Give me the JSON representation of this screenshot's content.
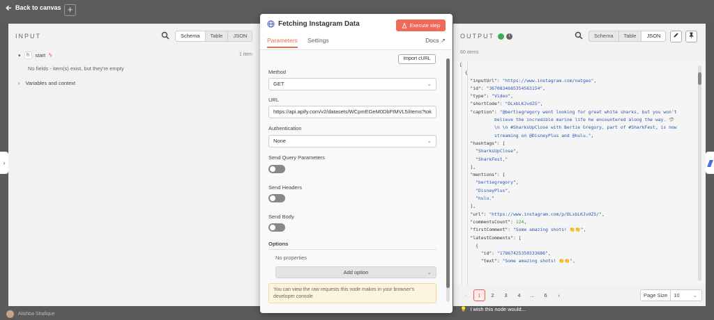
{
  "topbar": {
    "back_label": "Back to canvas",
    "plus_label": "+"
  },
  "input_panel": {
    "title": "INPUT",
    "views": [
      "Schema",
      "Table",
      "JSON"
    ],
    "active_view": "Schema",
    "start_label": "start",
    "item_count": "1 item",
    "empty_message": "No fields - item(s) exist, but they're empty",
    "vars_label": "Variables and context"
  },
  "modal": {
    "title": "Fetching Instagram Data",
    "execute_label": "Execute step",
    "tabs": [
      "Parameters",
      "Settings"
    ],
    "docs_label": "Docs",
    "import_label": "Import cURL",
    "method_label": "Method",
    "method_value": "GET",
    "url_label": "URL",
    "url_value": "https://api.apify.com/v2/datasets/WCpmEGeM0DbFtMVL5/items?tok",
    "auth_label": "Authentication",
    "auth_value": "None",
    "query_label": "Send Query Parameters",
    "headers_label": "Send Headers",
    "body_label": "Send Body",
    "options_label": "Options",
    "no_props": "No properties",
    "add_option": "Add option",
    "note": "You can view the raw requests this node makes in your browser's developer console"
  },
  "output_panel": {
    "title": "OUTPUT",
    "views": [
      "Schema",
      "Table",
      "JSON"
    ],
    "active_view": "JSON",
    "item_count": "60 items",
    "json_lines": [
      [
        {
          "t": "p",
          "v": "["
        }
      ],
      [
        {
          "t": "p",
          "v": "  {"
        }
      ],
      [
        {
          "t": "k",
          "v": "    \"inputUrl\": "
        },
        {
          "t": "s",
          "v": "\"https://www.instagram.com/natgeo\""
        },
        {
          "t": "p",
          "v": ","
        }
      ],
      [
        {
          "t": "k",
          "v": "    \"id\": "
        },
        {
          "t": "s",
          "v": "\"3670834685354563154\""
        },
        {
          "t": "p",
          "v": ","
        }
      ],
      [
        {
          "t": "k",
          "v": "    \"type\": "
        },
        {
          "t": "s",
          "v": "\"Video\""
        },
        {
          "t": "p",
          "v": ","
        }
      ],
      [
        {
          "t": "k",
          "v": "    \"shortCode\": "
        },
        {
          "t": "s",
          "v": "\"DLxbLKJvdZS\""
        },
        {
          "t": "p",
          "v": ","
        }
      ],
      [
        {
          "t": "k",
          "v": "    \"caption\": "
        },
        {
          "t": "s",
          "v": "\"@bertiegregory went looking for great white sharks, but you won't"
        }
      ],
      [
        {
          "t": "s",
          "v": "             believe the incredible marine life he encountered along the way. 🦈"
        }
      ],
      [
        {
          "t": "s",
          "v": "             \\n \\n #SharksUpClose with Bertie Gregory, part of #SharkFest, is now"
        }
      ],
      [
        {
          "t": "s",
          "v": "             streaming on @DisneyPlus and @hulu.\""
        },
        {
          "t": "p",
          "v": ","
        }
      ],
      [
        {
          "t": "k",
          "v": "    \"hashtags\": ["
        }
      ],
      [
        {
          "t": "s",
          "v": "      \"SharksUpClose\""
        },
        {
          "t": "p",
          "v": ","
        }
      ],
      [
        {
          "t": "s",
          "v": "      \"SharkFest,\""
        }
      ],
      [
        {
          "t": "p",
          "v": "    ],"
        }
      ],
      [
        {
          "t": "k",
          "v": "    \"mentions\": ["
        }
      ],
      [
        {
          "t": "s",
          "v": "      \"bertiegregory\""
        },
        {
          "t": "p",
          "v": ","
        }
      ],
      [
        {
          "t": "s",
          "v": "      \"DisneyPlus\""
        },
        {
          "t": "p",
          "v": ","
        }
      ],
      [
        {
          "t": "s",
          "v": "      \"hulu.\""
        }
      ],
      [
        {
          "t": "p",
          "v": "    ],"
        }
      ],
      [
        {
          "t": "k",
          "v": "    \"url\": "
        },
        {
          "t": "s",
          "v": "\"https://www.instagram.com/p/DLxbLKJvdZS/\""
        },
        {
          "t": "p",
          "v": ","
        }
      ],
      [
        {
          "t": "k",
          "v": "    \"commentsCount\": "
        },
        {
          "t": "n",
          "v": "124"
        },
        {
          "t": "p",
          "v": ","
        }
      ],
      [
        {
          "t": "k",
          "v": "    \"firstComment\": "
        },
        {
          "t": "s",
          "v": "\"Some amazing shots! 👏👏\""
        },
        {
          "t": "p",
          "v": ","
        }
      ],
      [
        {
          "t": "k",
          "v": "    \"latestComments\": ["
        }
      ],
      [
        {
          "t": "p",
          "v": "      {"
        }
      ],
      [
        {
          "t": "k",
          "v": "        \"id\": "
        },
        {
          "t": "s",
          "v": "\"17867425350333686\""
        },
        {
          "t": "p",
          "v": ","
        }
      ],
      [
        {
          "t": "k",
          "v": "        \"text\": "
        },
        {
          "t": "s",
          "v": "\"Some amazing shots! 👏👏\""
        },
        {
          "t": "p",
          "v": ","
        }
      ]
    ],
    "pages": [
      "1",
      "2",
      "3",
      "4",
      "...",
      "6"
    ],
    "active_page": "1",
    "page_size_label": "Page Size",
    "page_size_value": "10"
  },
  "footer": {
    "user_name": "Alishba Shafique",
    "wish_text": "I wish this node would..."
  },
  "colors": {
    "accent": "#ee6a53",
    "success": "#3bab59",
    "string": "#2a57b0",
    "number": "#2f9a44"
  }
}
